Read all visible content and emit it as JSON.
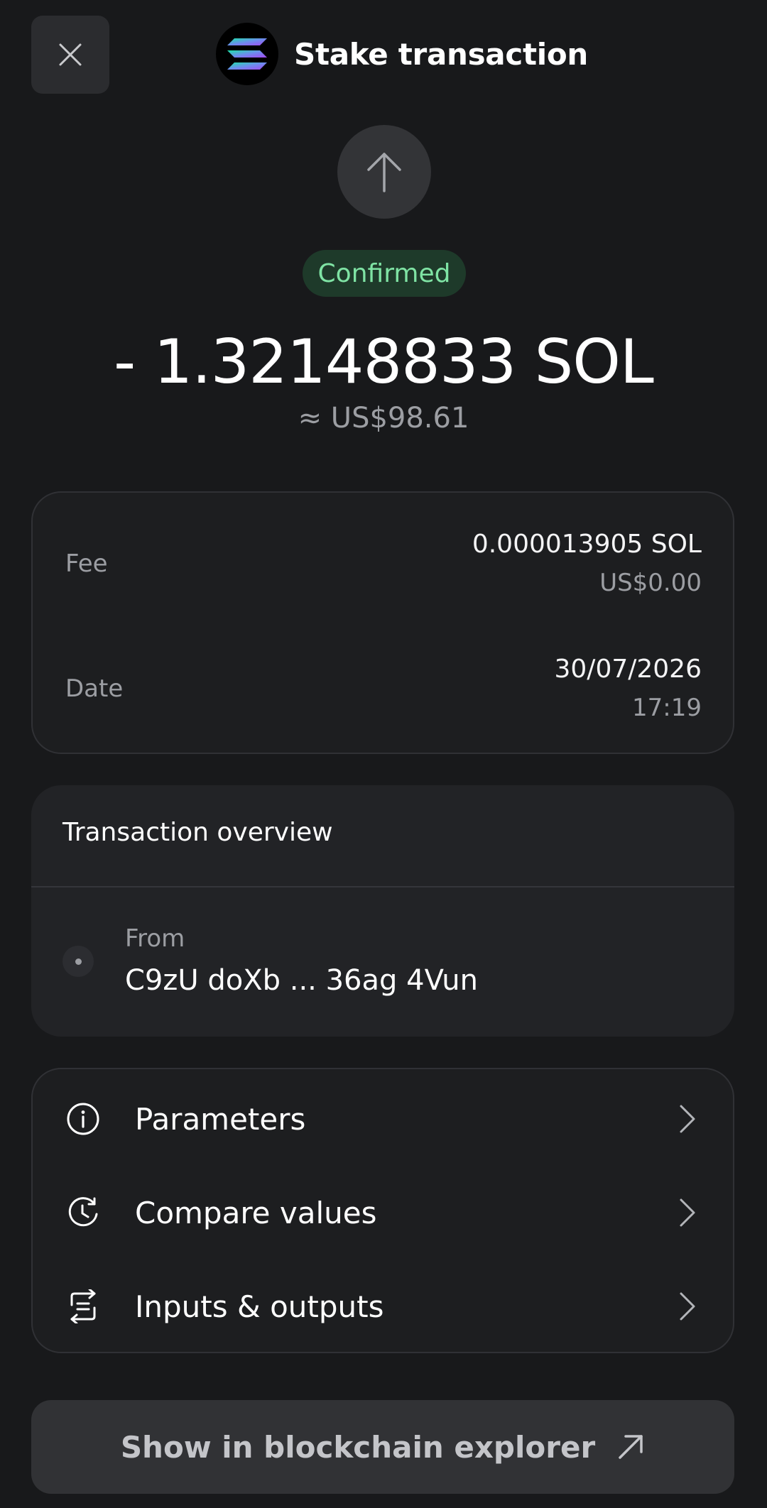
{
  "header": {
    "title": "Stake transaction",
    "token_logo": "solana-logo",
    "close_icon": "close-icon"
  },
  "transaction": {
    "direction_icon": "arrow-up-icon",
    "status": "Confirmed",
    "amount": "- 1.32148833 SOL",
    "amount_usd": "≈ US$98.61"
  },
  "details": {
    "fee_label": "Fee",
    "fee_value": "0.000013905 SOL",
    "fee_usd": "US$0.00",
    "date_label": "Date",
    "date_value": "30/07/2026",
    "time_value": "17:19"
  },
  "overview": {
    "title": "Transaction overview",
    "from_label": "From",
    "from_address": "C9zU doXb ... 36ag 4Vun"
  },
  "menu": {
    "items": [
      {
        "label": "Parameters",
        "icon": "info-icon"
      },
      {
        "label": "Compare values",
        "icon": "clock-history-icon"
      },
      {
        "label": "Inputs & outputs",
        "icon": "swap-icon"
      }
    ]
  },
  "explorer": {
    "label": "Show in blockchain explorer",
    "icon": "external-arrow-icon"
  },
  "colors": {
    "background": "#18191b",
    "card": "#1d1e20",
    "confirmed_text": "#7fe3a4",
    "confirmed_bg": "#1e3a2a",
    "muted_text": "#9c9ea3"
  }
}
